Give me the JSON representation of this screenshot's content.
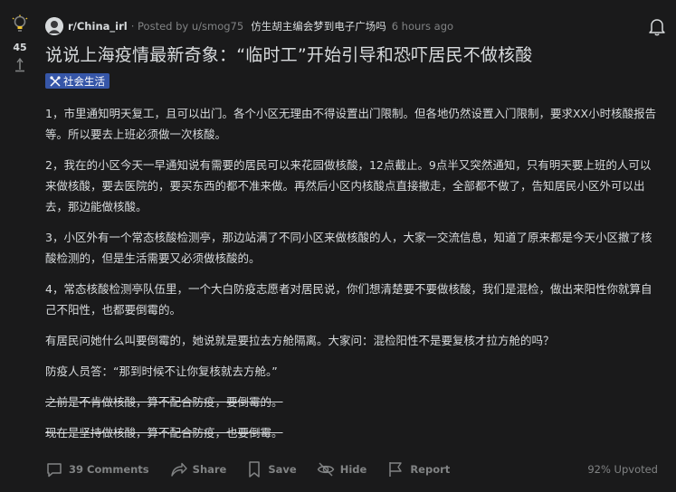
{
  "vote": {
    "score": "45"
  },
  "meta": {
    "subreddit": "r/China_irl",
    "posted_by": "· Posted by u/smog75",
    "flair": "仿生胡主编会梦到电子广场吗",
    "time": "6 hours ago"
  },
  "post": {
    "title": "说说上海疫情最新奇象：“临时工”开始引导和恐吓居民不做核酸",
    "tag": "社会生活",
    "paragraphs": [
      "1，市里通知明天复工，且可以出门。各个小区无理由不得设置出门限制。但各地仍然设置入门限制，要求XX小时核酸报告等。所以要去上班必须做一次核酸。",
      "2，我在的小区今天一早通知说有需要的居民可以来花园做核酸，12点截止。9点半又突然通知，只有明天要上班的人可以来做核酸，要去医院的，要买东西的都不准来做。再然后小区内核酸点直接撤走，全部都不做了，告知居民小区外可以出去，那边能做核酸。",
      "3，小区外有一个常态核酸检测亭，那边站满了不同小区来做核酸的人，大家一交流信息，知道了原来都是今天小区撤了核酸检测的，但是生活需要又必须做核酸的。",
      "4，常态核酸检测亭队伍里，一个大白防疫志愿者对居民说，你们想清楚要不要做核酸，我们是混检，做出来阳性你就算自己不阳性，也都要倒霉的。",
      "有居民问她什么叫要倒霉的，她说就是要拉去方舱隔离。大家问：混检阳性不是要复核才拉方舱的吗？",
      "防疫人员答：“那到时候不让你复核就去方舱。”"
    ],
    "struck": [
      "之前是不肯做核酸，算不配合防疫，要倒霉的。",
      "现在是坚持做核酸，算不配合防疫，也要倒霉。"
    ]
  },
  "actions": {
    "comments": "39 Comments",
    "share": "Share",
    "save": "Save",
    "hide": "Hide",
    "report": "Report",
    "upvoted": "92% Upvoted"
  }
}
